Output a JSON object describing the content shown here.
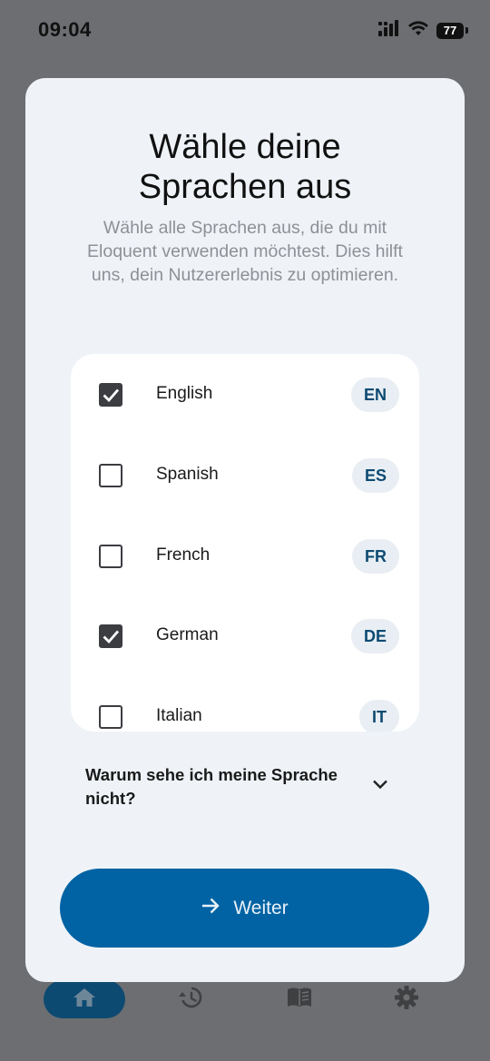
{
  "status_bar": {
    "time": "09:04",
    "battery": "77"
  },
  "modal": {
    "title_line1": "Wähle deine",
    "title_line2": "Sprachen aus",
    "subtitle": "Wähle alle Sprachen aus, die du mit Eloquent verwenden möchtest. Dies hilft uns, dein Nutzererlebnis zu optimieren.",
    "languages": [
      {
        "name": "English",
        "code": "EN",
        "checked": true
      },
      {
        "name": "Spanish",
        "code": "ES",
        "checked": false
      },
      {
        "name": "French",
        "code": "FR",
        "checked": false
      },
      {
        "name": "German",
        "code": "DE",
        "checked": true
      },
      {
        "name": "Italian",
        "code": "IT",
        "checked": false
      }
    ],
    "why_question": "Warum sehe ich meine Sprache nicht?",
    "continue_label": "Weiter"
  },
  "bottom_nav": {
    "items": [
      {
        "icon": "home-icon",
        "active": true
      },
      {
        "icon": "history-icon",
        "active": false
      },
      {
        "icon": "book-icon",
        "active": false
      },
      {
        "icon": "gear-icon",
        "active": false
      }
    ]
  },
  "colors": {
    "accent": "#0163a3",
    "nav_active": "#0d4a72",
    "overlay": "#6d6e71",
    "modal_bg": "#eff3f8"
  }
}
